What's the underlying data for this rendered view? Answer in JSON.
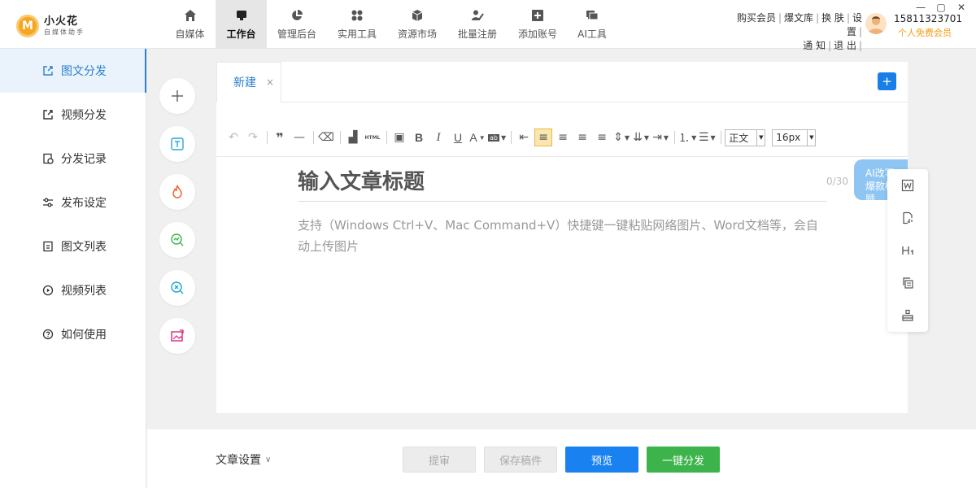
{
  "app": {
    "name": "小火花",
    "subtitle": "自媒体助手",
    "logo_letter": "M"
  },
  "nav": {
    "tabs": [
      {
        "label": "自媒体",
        "icon": "home-icon"
      },
      {
        "label": "工作台",
        "icon": "monitor-icon",
        "active": true
      },
      {
        "label": "管理后台",
        "icon": "pie-chart-icon"
      },
      {
        "label": "实用工具",
        "icon": "grid-icon"
      },
      {
        "label": "资源市场",
        "icon": "box-icon"
      },
      {
        "label": "批量注册",
        "icon": "user-edit-icon"
      },
      {
        "label": "添加账号",
        "icon": "plus-square-icon"
      },
      {
        "label": "AI工具",
        "icon": "chat-icon"
      }
    ]
  },
  "top_links": {
    "row1": [
      "购买会员",
      "爆文库",
      "换 肤",
      "设 置"
    ],
    "row2": [
      "通 知",
      "退 出"
    ]
  },
  "user": {
    "phone": "15811323701",
    "level": "个人免费会员"
  },
  "window": {
    "minimize": "—",
    "maximize": "▢",
    "close": "✕"
  },
  "sidebar": {
    "items": [
      {
        "label": "图文分发",
        "icon": "external-edit-icon",
        "active": true
      },
      {
        "label": "视频分发",
        "icon": "external-link-icon"
      },
      {
        "label": "分发记录",
        "icon": "record-icon"
      },
      {
        "label": "发布设定",
        "icon": "sliders-icon"
      },
      {
        "label": "图文列表",
        "icon": "list-doc-icon"
      },
      {
        "label": "视频列表",
        "icon": "play-circle-icon"
      },
      {
        "label": "如何使用",
        "icon": "help-circle-icon"
      }
    ]
  },
  "tools": [
    {
      "icon": "plus-icon",
      "color": "#666666"
    },
    {
      "icon": "text-box-icon",
      "color": "#29a8d8"
    },
    {
      "icon": "fire-icon",
      "color": "#f05a28"
    },
    {
      "icon": "search-chart-icon",
      "color": "#3cb44b"
    },
    {
      "icon": "search-x-icon",
      "color": "#1aa9c9"
    },
    {
      "icon": "image-edit-icon",
      "color": "#d6297a"
    }
  ],
  "editor": {
    "tab_label": "新建",
    "tab_close": "×",
    "add_tab": "+",
    "toolbar": {
      "html_label": "HTML",
      "format_select": "正文",
      "size_select": "16px"
    },
    "title_placeholder": "输入文章标题",
    "title_count": "0/30",
    "body_placeholder": "支持（Windows Ctrl+V、Mac Command+V）快捷键一键粘贴网络图片、Word文档等，会自动上传图片",
    "ai_button": "AI改写爆款标题"
  },
  "float_panel": [
    "word-icon",
    "doc-refresh-icon",
    "heading-icon",
    "copy-icon",
    "format-brush-icon"
  ],
  "footer": {
    "settings_label": "文章设置",
    "buttons": {
      "extract": "提审",
      "save_draft": "保存稿件",
      "preview": "预览",
      "publish": "一键分发"
    }
  },
  "colors": {
    "accent": "#2b7fd1",
    "primary_button": "#1a82f0",
    "publish_button": "#3cb44b",
    "logo": "#f5a623"
  }
}
